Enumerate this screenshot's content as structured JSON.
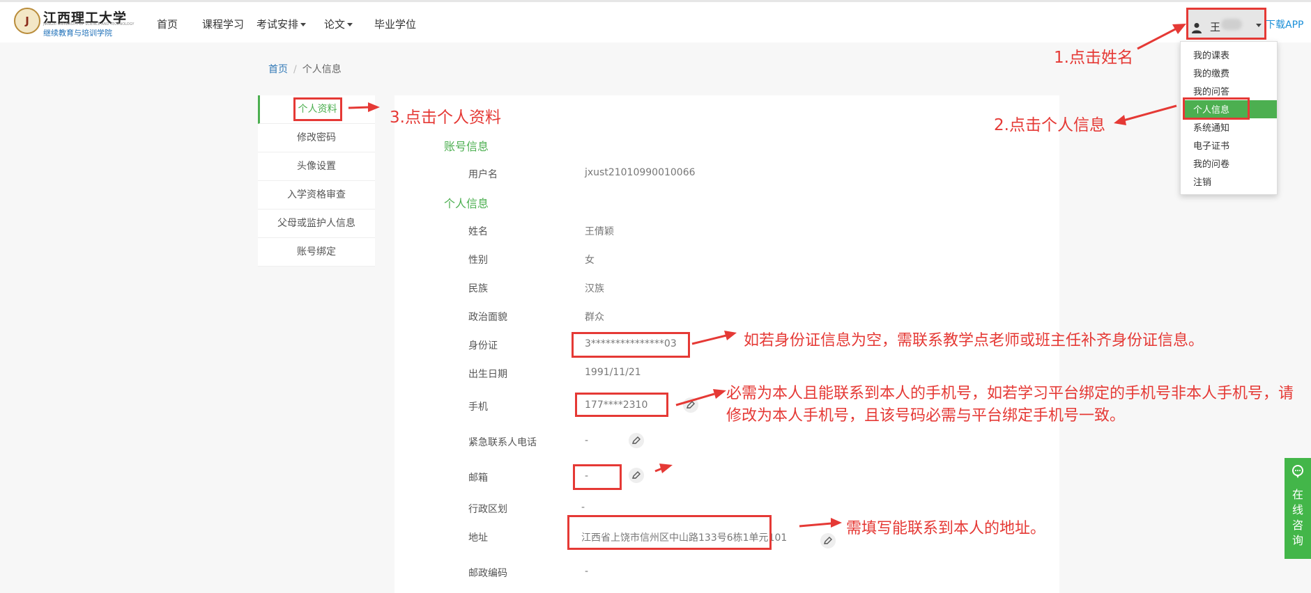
{
  "header": {
    "logo": {
      "name": "江西理工大学",
      "english": "JIANGXI UNIVERSITY OF SCIENCE AND TECHNOLOGY",
      "subtitle": "继续教育与培训学院"
    },
    "nav": [
      {
        "label": "首页",
        "dropdown": false
      },
      {
        "label": "课程学习",
        "dropdown": false
      },
      {
        "label": "考试安排",
        "dropdown": true
      },
      {
        "label": "论文",
        "dropdown": true
      },
      {
        "label": "毕业学位",
        "dropdown": false
      }
    ],
    "user": {
      "name": "王"
    },
    "download": "下载APP"
  },
  "user_menu": {
    "items": [
      "我的课表",
      "我的缴费",
      "我的问答",
      "个人信息",
      "系统通知",
      "电子证书",
      "我的问卷",
      "注销"
    ],
    "active_index": 3
  },
  "breadcrumb": {
    "home": "首页",
    "separator": "/",
    "current": "个人信息"
  },
  "sidebar": {
    "items": [
      "个人资料",
      "修改密码",
      "头像设置",
      "入学资格审查",
      "父母或监护人信息",
      "账号绑定"
    ],
    "active_index": 0
  },
  "account": {
    "title": "账号信息",
    "username_label": "用户名",
    "username_value": "jxust21010990010066"
  },
  "personal": {
    "title": "个人信息",
    "fields": [
      {
        "label": "姓名",
        "value": "王倩颖"
      },
      {
        "label": "性别",
        "value": "女"
      },
      {
        "label": "民族",
        "value": "汉族"
      },
      {
        "label": "政治面貌",
        "value": "群众"
      },
      {
        "label": "身份证",
        "value": "3***************03"
      },
      {
        "label": "出生日期",
        "value": "1991/11/21"
      },
      {
        "label": "手机",
        "value": "177****2310"
      },
      {
        "label": "紧急联系人电话",
        "value": "-"
      },
      {
        "label": "邮箱",
        "value": "-"
      },
      {
        "label": "行政区划",
        "value": "-"
      },
      {
        "label": "地址",
        "value": "江西省上饶市信州区中山路133号6栋1单元101"
      },
      {
        "label": "邮政编码",
        "value": "-"
      }
    ]
  },
  "annotations": {
    "step1": "1.点击姓名",
    "step2": "2.点击个人信息",
    "step3": "3.点击个人资料",
    "id_note": "如若身份证信息为空，需联系教学点老师或班主任补齐身份证信息。",
    "phone_note": "必需为本人且能联系到本人的手机号，如若学习平台绑定的手机号非本人手机号，请修改为本人手机号，且该号码必需与平台绑定手机号一致。",
    "address_note": "需填写能联系到本人的地址。"
  },
  "consult": {
    "label": "在线咨询"
  },
  "colors": {
    "accent_green": "#4caf50",
    "annotation_red": "#e53935",
    "link_blue": "#337ab7"
  }
}
